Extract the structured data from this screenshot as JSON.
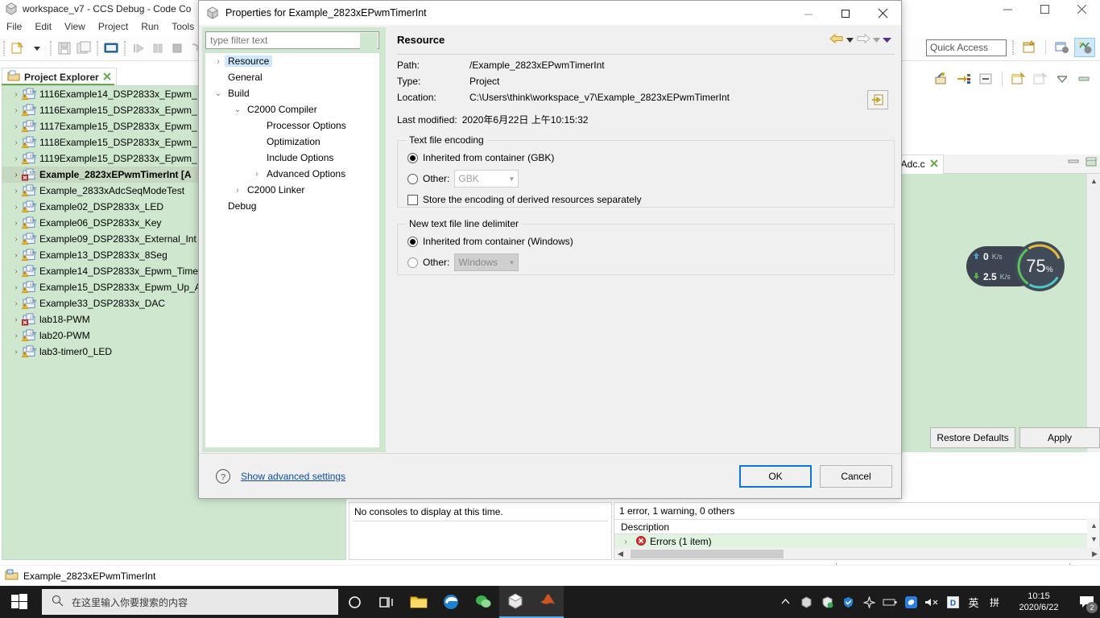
{
  "ide": {
    "title": "workspace_v7 - CCS Debug - Code Co",
    "menus": [
      "File",
      "Edit",
      "View",
      "Project",
      "Run",
      "Tools"
    ],
    "quick_access_placeholder": "Quick Access",
    "status_text": "Example_2823xEPwmTimerInt"
  },
  "project_explorer": {
    "tab_label": "Project Explorer",
    "items": [
      {
        "label": "1116Example14_DSP2833x_Epwm_",
        "icon": "ccs-project-warning-icon",
        "selected": false
      },
      {
        "label": "1116Example15_DSP2833x_Epwm_",
        "icon": "ccs-project-warning-icon",
        "selected": false
      },
      {
        "label": "1117Example15_DSP2833x_Epwm_",
        "icon": "ccs-project-warning-icon",
        "selected": false
      },
      {
        "label": "1118Example15_DSP2833x_Epwm_",
        "icon": "ccs-project-warning-icon",
        "selected": false
      },
      {
        "label": "1119Example15_DSP2833x_Epwm_",
        "icon": "ccs-project-warning-icon",
        "selected": false
      },
      {
        "label": "Example_2823xEPwmTimerInt  [A",
        "icon": "ccs-project-error-icon",
        "selected": true
      },
      {
        "label": "Example_2833xAdcSeqModeTest",
        "icon": "ccs-project-warning-icon",
        "selected": false
      },
      {
        "label": "Example02_DSP2833x_LED",
        "icon": "ccs-project-warning-icon",
        "selected": false
      },
      {
        "label": "Example06_DSP2833x_Key",
        "icon": "ccs-project-warning-icon",
        "selected": false
      },
      {
        "label": "Example09_DSP2833x_External_Int",
        "icon": "ccs-project-warning-icon",
        "selected": false
      },
      {
        "label": "Example13_DSP2833x_8Seg",
        "icon": "ccs-project-warning-icon",
        "selected": false
      },
      {
        "label": "Example14_DSP2833x_Epwm_Time",
        "icon": "ccs-project-warning-icon",
        "selected": false
      },
      {
        "label": "Example15_DSP2833x_Epwm_Up_A",
        "icon": "ccs-project-warning-icon",
        "selected": false
      },
      {
        "label": "Example33_DSP2833x_DAC",
        "icon": "ccs-project-warning-icon",
        "selected": false
      },
      {
        "label": "lab18-PWM",
        "icon": "ccs-project-error-icon",
        "selected": false
      },
      {
        "label": "lab20-PWM",
        "icon": "ccs-project-warning-icon",
        "selected": false
      },
      {
        "label": "lab3-timer0_LED",
        "icon": "ccs-project-warning-icon",
        "selected": false
      }
    ]
  },
  "editor": {
    "tab_label": "_Adc.c"
  },
  "console": {
    "message": "No consoles to display at this time."
  },
  "problems": {
    "summary": "1 error, 1 warning, 0 others",
    "column_header": "Description",
    "rows": [
      {
        "label": "Errors (1 item)",
        "icon": "error-icon"
      }
    ]
  },
  "network_widget": {
    "upload": "0",
    "upload_unit": "K/s",
    "download": "2.5",
    "download_unit": "K/s",
    "percent": "75",
    "percent_unit": "%"
  },
  "dialog": {
    "title": "Properties for Example_2823xEPwmTimerInt",
    "filter_placeholder": "type filter text",
    "tree": [
      {
        "label": "Resource",
        "depth": 0,
        "twisty": "collapsed",
        "selected": true
      },
      {
        "label": "General",
        "depth": 0,
        "twisty": "none",
        "selected": false
      },
      {
        "label": "Build",
        "depth": 0,
        "twisty": "expanded",
        "selected": false
      },
      {
        "label": "C2000 Compiler",
        "depth": 1,
        "twisty": "expanded",
        "selected": false
      },
      {
        "label": "Processor Options",
        "depth": 2,
        "twisty": "none",
        "selected": false
      },
      {
        "label": "Optimization",
        "depth": 2,
        "twisty": "none",
        "selected": false
      },
      {
        "label": "Include Options",
        "depth": 2,
        "twisty": "none",
        "selected": false
      },
      {
        "label": "Advanced Options",
        "depth": 2,
        "twisty": "collapsed",
        "selected": false
      },
      {
        "label": "C2000 Linker",
        "depth": 1,
        "twisty": "collapsed",
        "selected": false
      },
      {
        "label": "Debug",
        "depth": 0,
        "twisty": "none",
        "selected": false
      }
    ],
    "page": {
      "heading": "Resource",
      "fields": [
        {
          "label": "Path:",
          "value": "/Example_2823xEPwmTimerInt"
        },
        {
          "label": "Type:",
          "value": "Project"
        },
        {
          "label": "Location:",
          "value": "C:\\Users\\think\\workspace_v7\\Example_2823xEPwmTimerInt"
        }
      ],
      "last_modified_label": "Last modified:",
      "last_modified_value": "2020年6月22日 上午10:15:32",
      "encoding_group": {
        "title": "Text file encoding",
        "inherited_label": "Inherited from container (GBK)",
        "other_label": "Other:",
        "other_value": "GBK",
        "store_derived_label": "Store the encoding of derived resources separately"
      },
      "delimiter_group": {
        "title": "New text file line delimiter",
        "inherited_label": "Inherited from container (Windows)",
        "other_label": "Other:",
        "other_value": "Windows"
      },
      "restore_defaults_label": "Restore Defaults",
      "apply_label": "Apply"
    },
    "footer": {
      "advanced_link": "Show advanced settings",
      "ok_label": "OK",
      "cancel_label": "Cancel"
    }
  },
  "taskbar": {
    "search_placeholder": "在这里输入你要搜索的内容",
    "clock_time": "10:15",
    "clock_date": "2020/6/22",
    "ime_lang": "英",
    "ime_mode": "拼",
    "notification_count": "2"
  }
}
